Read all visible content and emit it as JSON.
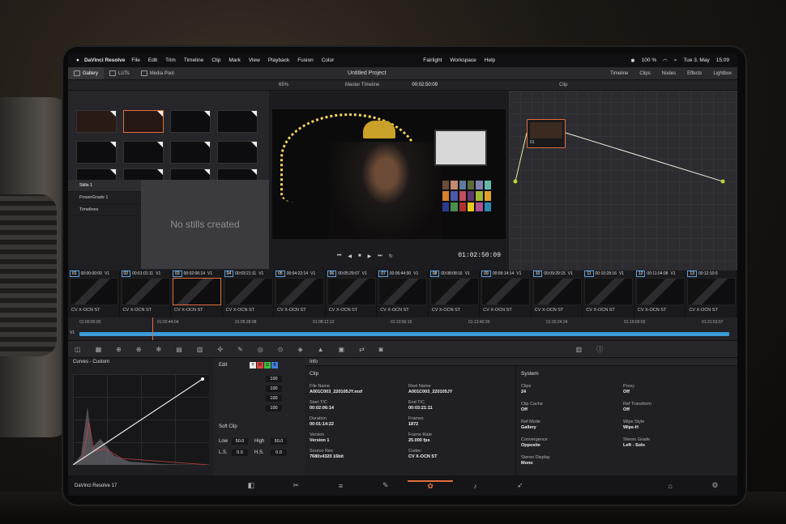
{
  "menubar": {
    "app": "DaVinci Resolve",
    "items": [
      "File",
      "Edit",
      "Trim",
      "Timeline",
      "Clip",
      "Mark",
      "View",
      "Playback",
      "Fusion",
      "Color",
      "Fairlight",
      "Workspace",
      "Help"
    ],
    "battery": "100 %",
    "date": "Tue 3. May",
    "time": "15:09"
  },
  "project": {
    "title": "Untitled Project"
  },
  "panels": {
    "gallery": "Gallery",
    "luts": "LUTs",
    "media_pool": "Media Pool",
    "timeline": "Timeline",
    "clips": "Clips",
    "nodes": "Nodes",
    "effects": "Effects",
    "lightbox": "Lightbox"
  },
  "viewer": {
    "zoom": "65%",
    "timeline_name": "Master Timeline",
    "timecode": "00:02:50:09",
    "playhead_tc": "01:02:50:09",
    "node_mode": "Clip"
  },
  "stills": {
    "items": [
      "Stills 1",
      "PowerGrade 1",
      "Timelines"
    ],
    "empty": "No stills created"
  },
  "node": {
    "label": "01"
  },
  "clips": [
    {
      "n": "01",
      "tc": "00:00:00:00",
      "track": "V1",
      "codec": "CV X-OCN ST"
    },
    {
      "n": "02",
      "tc": "00:01:01:11",
      "track": "V1",
      "codec": "CV X-OCN ST"
    },
    {
      "n": "03",
      "tc": "00:02:06:14",
      "track": "V1",
      "codec": "CV X-OCN ST"
    },
    {
      "n": "04",
      "tc": "00:03:21:11",
      "track": "V1",
      "codec": "CV X-OCN ST"
    },
    {
      "n": "05",
      "tc": "00:04:22:14",
      "track": "V1",
      "codec": "CV X-OCN ST"
    },
    {
      "n": "06",
      "tc": "00:05:29:07",
      "track": "V1",
      "codec": "CV X-OCN ST"
    },
    {
      "n": "07",
      "tc": "00:06:44:00",
      "track": "V1",
      "codec": "CV X-OCN ST"
    },
    {
      "n": "08",
      "tc": "00:08:08:16",
      "track": "V1",
      "codec": "CV X-OCN ST"
    },
    {
      "n": "09",
      "tc": "00:09:14:14",
      "track": "V1",
      "codec": "CV X-OCN ST"
    },
    {
      "n": "10",
      "tc": "00:09:29:15",
      "track": "V1",
      "codec": "CV X-OCN ST"
    },
    {
      "n": "11",
      "tc": "00:10:28:16",
      "track": "V1",
      "codec": "CV X-OCN ST"
    },
    {
      "n": "12",
      "tc": "00:11:04:08",
      "track": "V1",
      "codec": "CV X-OCN ST"
    },
    {
      "n": "13",
      "tc": "00:12:10:0",
      "track": "",
      "codec": "CV X-OCN ST"
    }
  ],
  "ruler": [
    "01:00:00:00",
    "01:02:44:04",
    "01:05:28:08",
    "01:08:12:12",
    "01:10:56:16",
    "01:13:40:20",
    "01:16:24:24",
    "01:19:09:03",
    "01:21:53:07"
  ],
  "curves": {
    "title": "Curves - Custom",
    "edit": "Edit",
    "values": [
      "100",
      "100",
      "100",
      "100"
    ],
    "soft_clip": "Soft Clip",
    "low_label": "Low",
    "low": "50.0",
    "high_label": "High",
    "high": "50.0",
    "ls_label": "L.S.",
    "ls": "0.0",
    "hs_label": "H.S.",
    "hs": "0.0"
  },
  "info": {
    "header": "Info",
    "clip_section": "Clip",
    "system_section": "System",
    "file_name_l": "File Name",
    "file_name": "A001C003_220105JY.mxf",
    "reel_name_l": "Reel Name",
    "reel_name": "A001C003_220105JY",
    "start_l": "Start T/C",
    "start": "00:02:06:14",
    "end_l": "End T/C",
    "end": "00:03:21:11",
    "duration_l": "Duration",
    "duration": "00:01:14:22",
    "frames_l": "Frames",
    "frames": "1872",
    "version_l": "Version",
    "version": "Version 1",
    "fps_l": "Frame Rate",
    "fps": "25.000 fps",
    "res_l": "Source Res",
    "res": "7680x4320 16bit",
    "codec_l": "Codec",
    "codec": "CV X-OCN ST",
    "clips_l": "Clips",
    "clips": "24",
    "proxy_l": "Proxy",
    "proxy": "Off",
    "cache_l": "Clip Cache",
    "cache": "Off",
    "rt_l": "Ref Transform",
    "rt": "Off",
    "rm_l": "Ref Mode",
    "rm": "Gallery",
    "ws_l": "Wipe Style",
    "ws": "Wipe-H",
    "conv_l": "Convergence",
    "conv": "Opposite",
    "sg_l": "Stereo Grade",
    "sg": "Left - Solo",
    "sd_l": "Stereo Display",
    "sd": "Mono"
  },
  "footer": {
    "app_version": "DaVinci Resolve 17"
  }
}
